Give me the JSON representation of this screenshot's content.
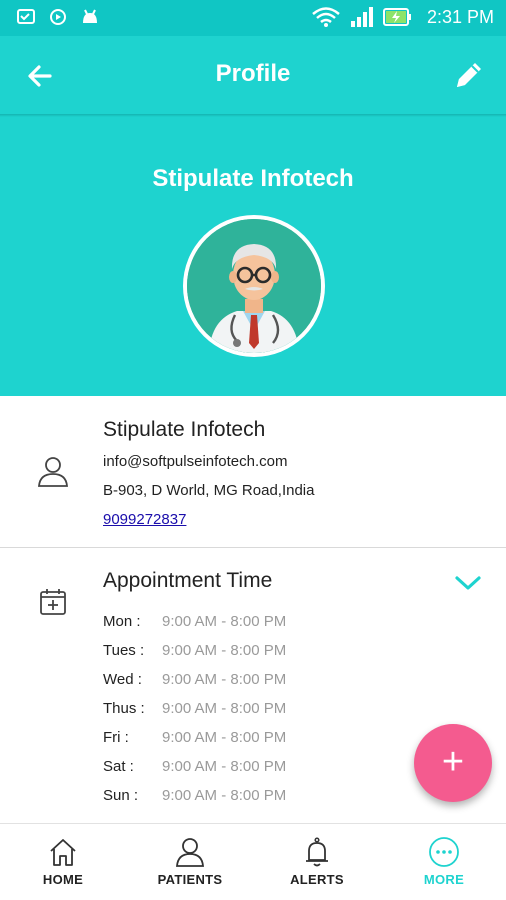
{
  "status_bar": {
    "time": "2:31 PM",
    "icons": [
      "cast-icon",
      "sync-icon",
      "android-icon",
      "wifi-icon",
      "signal-icon",
      "battery-charging-icon"
    ]
  },
  "app_bar": {
    "title": "Profile",
    "back_icon": "arrow-left-icon",
    "edit_icon": "pencil-icon"
  },
  "profile": {
    "header_name": "Stipulate Infotech",
    "name": "Stipulate Infotech",
    "email": "info@softpulseinfotech.com",
    "address": "B-903, D World, MG Road,India",
    "phone": "9099272837"
  },
  "appointment": {
    "title": "Appointment Time",
    "schedule": [
      {
        "day": "Mon :",
        "time": "9:00 AM - 8:00 PM"
      },
      {
        "day": "Tues :",
        "time": "9:00 AM - 8:00 PM"
      },
      {
        "day": "Wed :",
        "time": "9:00 AM - 8:00 PM"
      },
      {
        "day": "Thus :",
        "time": "9:00 AM - 8:00 PM"
      },
      {
        "day": "Fri :",
        "time": "9:00 AM - 8:00 PM"
      },
      {
        "day": "Sat :",
        "time": "9:00 AM - 8:00 PM"
      },
      {
        "day": "Sun :",
        "time": "9:00 AM - 8:00 PM"
      }
    ]
  },
  "fab": {
    "label": "+"
  },
  "bottom_nav": {
    "items": [
      {
        "label": "HOME",
        "icon": "home-icon"
      },
      {
        "label": "PATIENTS",
        "icon": "person-icon"
      },
      {
        "label": "ALERTS",
        "icon": "bell-icon"
      },
      {
        "label": "MORE",
        "icon": "more-icon"
      }
    ],
    "active": "MORE"
  },
  "colors": {
    "primary": "#1ed3cf",
    "status_bar": "#10c6c4",
    "fab": "#f45b8f",
    "link": "#1a0dab",
    "muted_text": "#9a9a9a"
  }
}
